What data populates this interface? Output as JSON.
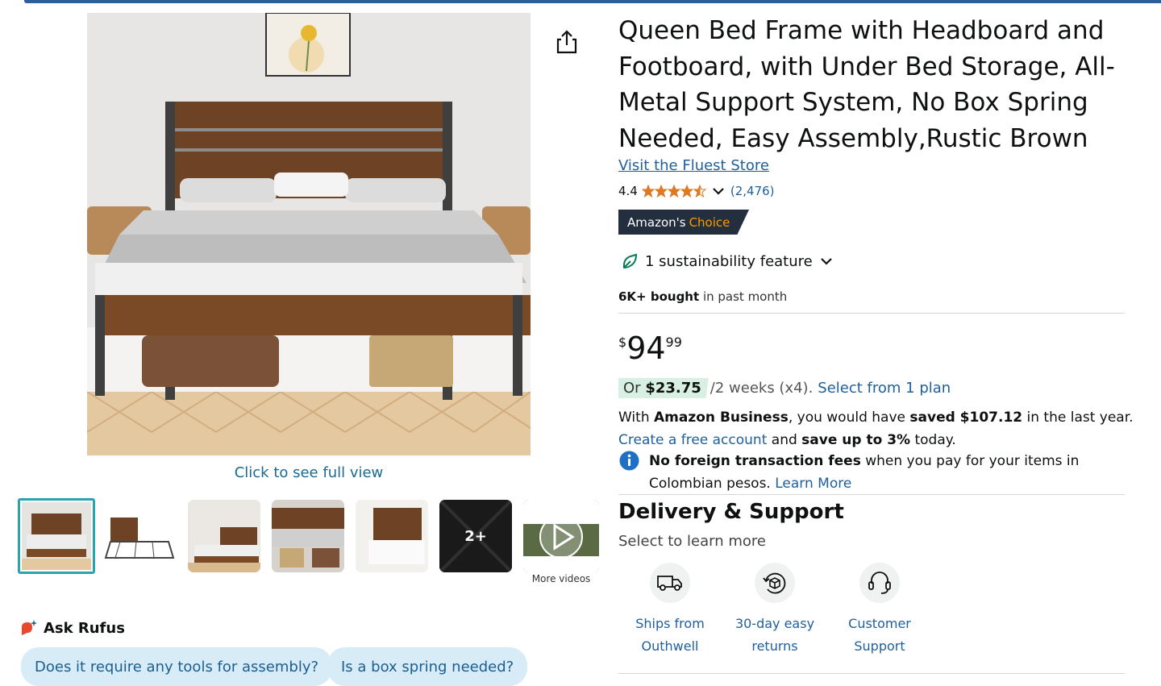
{
  "product": {
    "title": "Queen Bed Frame with Headboard and Footboard, with Under Bed Storage, All-Metal Support System, No Box Spring Needed, Easy Assembly,Rustic Brown",
    "store_link": "Visit the Fluest Store",
    "rating_value": "4.4",
    "rating_count": "(2,476)",
    "rating_stars": 4.4,
    "choice_badge": {
      "prefix": "Amazon's",
      "accent": "Choice"
    },
    "sustainability": "1 sustainability feature",
    "bought": {
      "bold": "6K+ bought",
      "rest": "in past month"
    }
  },
  "gallery": {
    "full_view_label": "Click to see full view",
    "more_badge": "2+",
    "more_videos_label": "More videos"
  },
  "price": {
    "symbol": "$",
    "whole": "94",
    "fraction": "99"
  },
  "installment": {
    "prefix": "Or",
    "amount": "$23.75",
    "schedule": "/2 weeks (x4).",
    "link": "Select from 1 plan"
  },
  "business": {
    "t1": "With ",
    "b1": "Amazon Business",
    "t2": ", you would have ",
    "b2": "saved $107.12",
    "t3": " in the last year.",
    "link": "Create a free account",
    "t4": " and ",
    "b3": "save up to 3%",
    "t5": " today."
  },
  "fees": {
    "bold": "No foreign transaction fees",
    "text": " when you pay for your items in Colombian pesos. ",
    "link": "Learn More"
  },
  "delivery": {
    "title": "Delivery & Support",
    "subtitle": "Select to learn more",
    "items": [
      {
        "line1": "Ships from",
        "line2": "Outhwell",
        "icon": "truck-icon"
      },
      {
        "line1": "30-day easy",
        "line2": "returns",
        "icon": "return-box-icon"
      },
      {
        "line1": "Customer",
        "line2": "Support",
        "icon": "headset-icon"
      }
    ]
  },
  "rufus": {
    "title": "Ask Rufus",
    "chips": [
      "Does it require any tools for assembly?",
      "Is a box spring needed?"
    ]
  },
  "colors": {
    "link": "#1f5f9b",
    "badge_dark": "#232f3e",
    "badge_accent": "#ff9900",
    "star": "#de7921",
    "chip_bg": "#d8ecf8",
    "install_bg": "#d8f0e3"
  }
}
